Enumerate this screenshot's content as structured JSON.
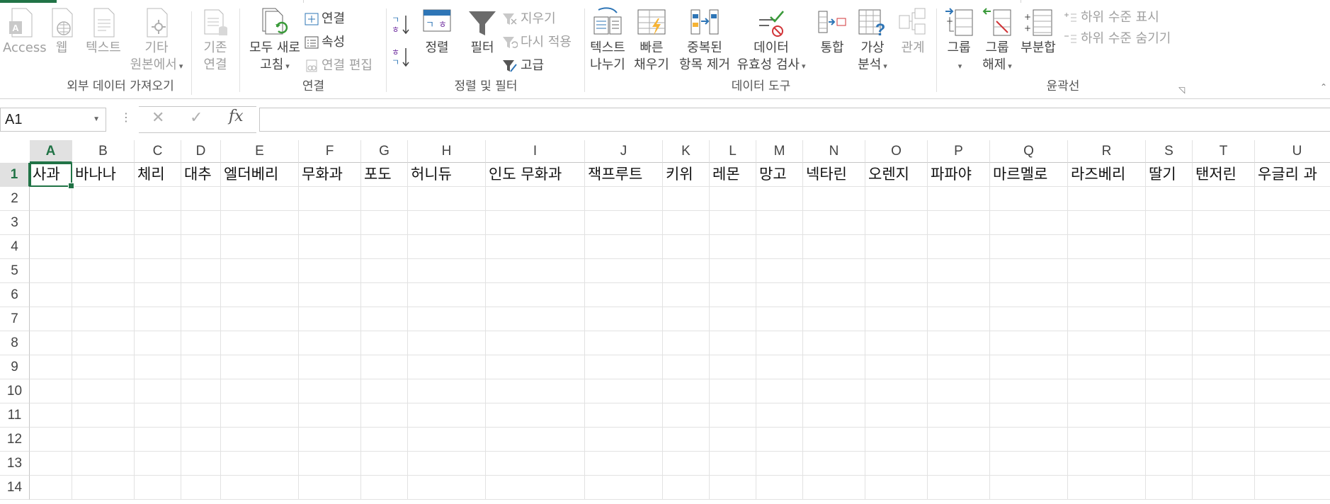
{
  "ribbon": {
    "groups": {
      "external": {
        "label": "외부 데이터 가져오기",
        "access": "Access",
        "web": "웹",
        "text": "텍스트",
        "other_l1": "기타",
        "other_l2": "원본에서",
        "existing_l1": "기존",
        "existing_l2": "연결"
      },
      "connections": {
        "label": "연결",
        "refresh_l1": "모두 새로",
        "refresh_l2": "고침",
        "connections": "연결",
        "properties": "속성",
        "edit_links": "연결 편집"
      },
      "sortfilter": {
        "label": "정렬 및 필터",
        "sort": "정렬",
        "filter": "필터",
        "clear": "지우기",
        "reapply": "다시 적용",
        "advanced": "고급"
      },
      "datatools": {
        "label": "데이터 도구",
        "text_to_cols_l1": "텍스트",
        "text_to_cols_l2": "나누기",
        "flash_l1": "빠른",
        "flash_l2": "채우기",
        "dup_l1": "중복된",
        "dup_l2": "항목 제거",
        "valid_l1": "데이터",
        "valid_l2": "유효성 검사",
        "consolidate": "통합",
        "whatif_l1": "가상",
        "whatif_l2": "분석",
        "relations": "관계"
      },
      "outline": {
        "label": "윤곽선",
        "group": "그룹",
        "ungroup_l1": "그룹",
        "ungroup_l2": "해제",
        "subtotal": "부분합",
        "show_detail": "하위 수준 표시",
        "hide_detail": "하위 수준 숨기기"
      }
    }
  },
  "formula_bar": {
    "name_box": "A1",
    "cancel_glyph": "✕",
    "enter_glyph": "✓",
    "fx": "fx",
    "content": ""
  },
  "sheet": {
    "columns": [
      "A",
      "B",
      "C",
      "D",
      "E",
      "F",
      "G",
      "H",
      "I",
      "J",
      "K",
      "L",
      "M",
      "N",
      "O",
      "P",
      "Q",
      "R",
      "S",
      "T",
      "U"
    ],
    "rows": [
      "1",
      "2",
      "3",
      "4",
      "5",
      "6",
      "7",
      "8",
      "9",
      "10",
      "11",
      "12",
      "13",
      "14"
    ],
    "row1": [
      "사과",
      "바나나",
      "체리",
      "대추",
      "엘더베리",
      "무화과",
      "포도",
      "허니듀",
      "인도 무화과",
      "잭프루트",
      "키위",
      "레몬",
      "망고",
      "넥타린",
      "오렌지",
      "파파야",
      "마르멜로",
      "라즈베리",
      "딸기",
      "탠저린",
      "우글리 과"
    ],
    "active_cell": "A1"
  },
  "colors": {
    "accent": "#217346",
    "sort_blue": "#2e75b6",
    "purple": "#7030a0"
  }
}
